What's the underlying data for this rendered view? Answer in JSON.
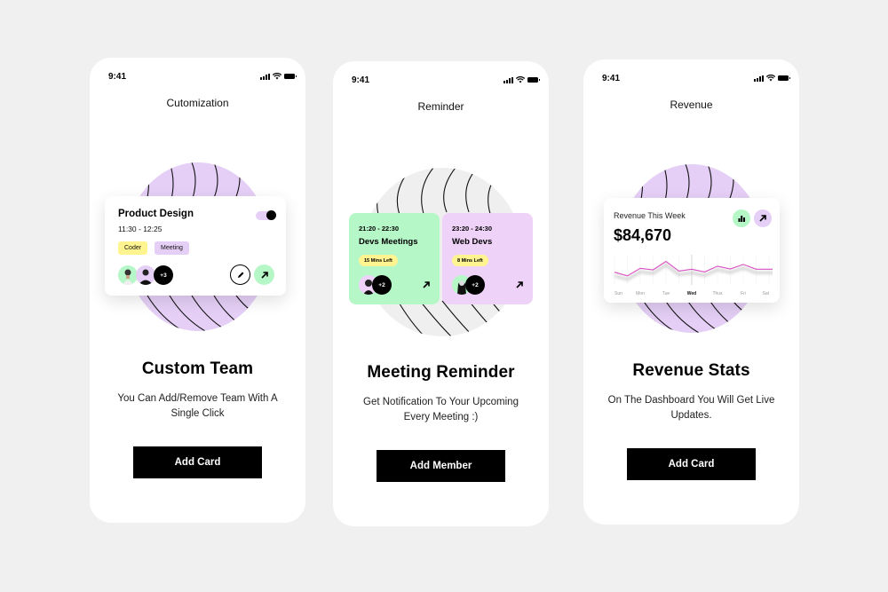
{
  "screens": [
    {
      "status_time": "9:41",
      "nav_title": "Cutomization",
      "card": {
        "title": "Product Design",
        "time": "11:30 - 12:25",
        "tags": [
          "Coder",
          "Meeting"
        ],
        "toggle_on": true,
        "more_members": "+3",
        "icons": [
          "edit-pencil-icon",
          "arrow-up-right-icon"
        ]
      },
      "title": "Custom Team",
      "description": "You Can Add/Remove Team With A Single Click",
      "button": "Add Card"
    },
    {
      "status_time": "9:41",
      "nav_title": "Reminder",
      "cards": [
        {
          "time": "21:20 - 22:30",
          "title": "Devs Meetings",
          "time_left": "15 Mins Left",
          "more_members": "+2",
          "color": "#b6f7c8"
        },
        {
          "time": "23:20 - 24:30",
          "title": "Web Devs",
          "time_left": "8 Mins Left",
          "more_members": "+2",
          "color": "#efd2f8"
        }
      ],
      "title": "Meeting Reminder",
      "description": "Get Notification To Your Upcoming Every Meeting :)",
      "button": "Add Member"
    },
    {
      "status_time": "9:41",
      "nav_title": "Revenue",
      "card": {
        "label": "Revenue This Week",
        "value": "$84,670",
        "icons": [
          "bar-chart-icon",
          "arrow-up-right-icon"
        ]
      },
      "title": "Revenue Stats",
      "description": "On The Dashboard You Will Get Live Updates.",
      "button": "Add Card"
    }
  ],
  "chart_data": {
    "type": "line",
    "title": "Revenue This Week",
    "categories": [
      "Sun",
      "Mon",
      "Tue",
      "Wed",
      "Thus",
      "Fri",
      "Sat"
    ],
    "highlighted_category": "Wed",
    "x": [
      0,
      0.5,
      1,
      1.5,
      2,
      2.5,
      3,
      3.5,
      4,
      4.5,
      5,
      5.5,
      6,
      6.5
    ],
    "values": [
      42,
      30,
      55,
      50,
      78,
      46,
      52,
      43,
      62,
      53,
      68,
      52,
      52,
      52
    ],
    "ylim": [
      0,
      100
    ],
    "line_color": "#d94fc2",
    "grid": true
  },
  "colors": {
    "background": "#f0f0f0",
    "purple": "#e5cff6",
    "green": "#b6f7c8",
    "yellow": "#fff48f",
    "grey_blob": "#efefef"
  }
}
